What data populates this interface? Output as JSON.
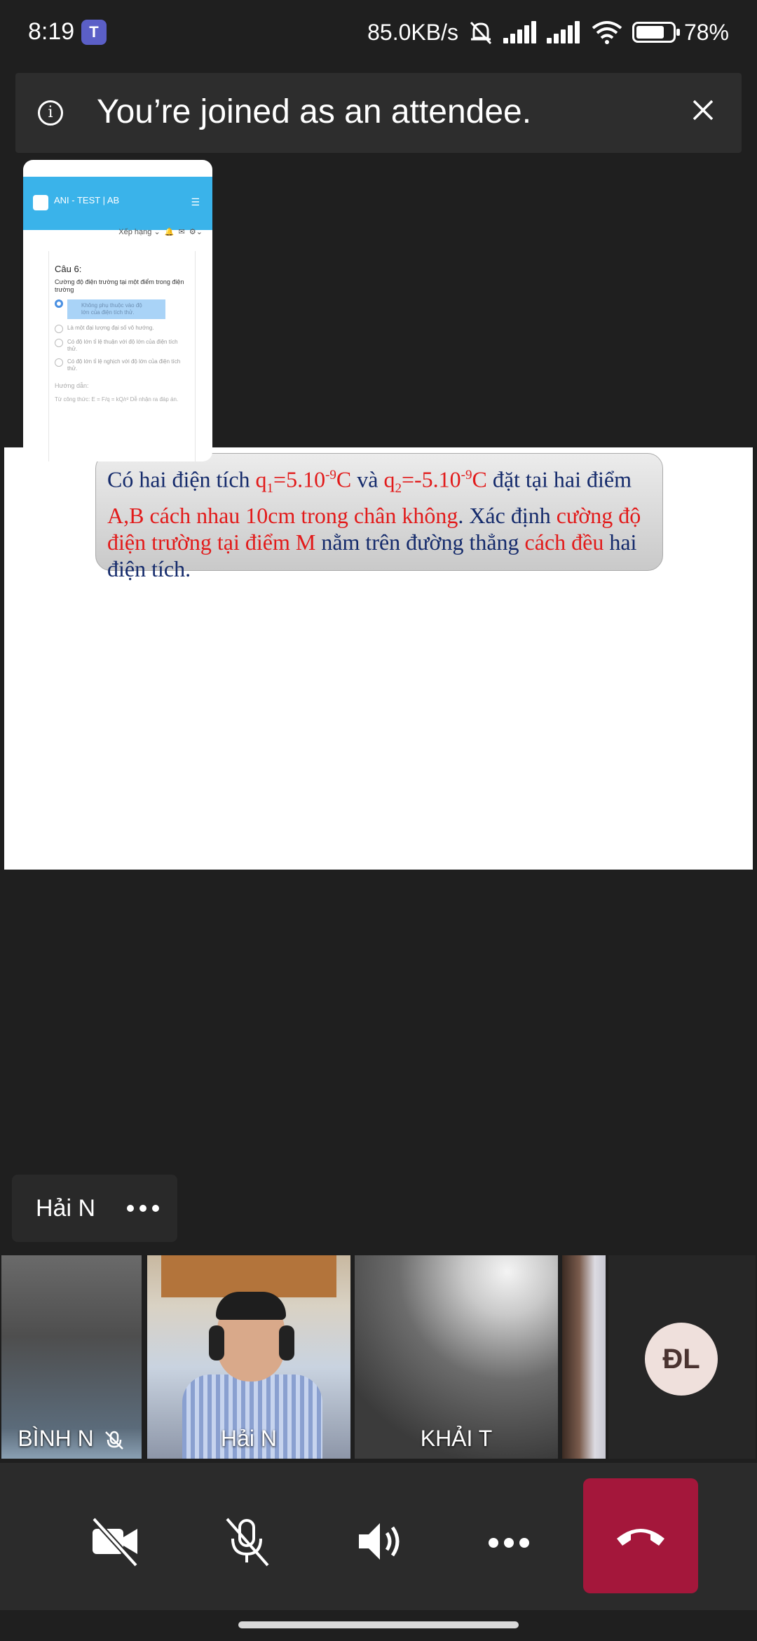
{
  "status_bar": {
    "time": "8:19",
    "network_speed": "85.0KB/s",
    "battery": "78%",
    "battery_level": 0.78
  },
  "banner": {
    "text": "You’re joined as an attendee."
  },
  "shared_slide": {
    "parts": [
      {
        "text": "Có hai điện tích ",
        "color": "blue"
      },
      {
        "text": "q",
        "color": "red"
      },
      {
        "text": "1",
        "color": "red",
        "sub": true
      },
      {
        "text": "=5.10",
        "color": "red"
      },
      {
        "text": "-9",
        "color": "red",
        "sup": true
      },
      {
        "text": "C",
        "color": "red"
      },
      {
        "text": " và ",
        "color": "blue"
      },
      {
        "text": "q",
        "color": "red"
      },
      {
        "text": "2",
        "color": "red",
        "sub": true
      },
      {
        "text": "=-5.10",
        "color": "red"
      },
      {
        "text": "-9",
        "color": "red",
        "sup": true
      },
      {
        "text": "C",
        "color": "red"
      },
      {
        "text": " đặt tại hai điểm ",
        "color": "blue"
      },
      {
        "text": "A,B cách nhau 10cm trong chân không",
        "color": "red"
      },
      {
        "text": ". Xác định ",
        "color": "blue"
      },
      {
        "text": "cường độ điện trường tại điểm M",
        "color": "red"
      },
      {
        "text": " nằm trên đường thẳng ",
        "color": "blue"
      },
      {
        "text": "cách đều",
        "color": "red"
      },
      {
        "text": " hai điện tích.",
        "color": "blue"
      }
    ]
  },
  "preview": {
    "app_title": "ANI - TEST | AB",
    "toolbar_label": "Xếp hạng",
    "question_number": "Câu 6:",
    "question_text": "Cường độ điện trường tại một điểm trong điện trường",
    "options": [
      {
        "text": "Không phụ thuộc vào độ lớn của điện tích thử.",
        "selected": true
      },
      {
        "text": "Là một đại lượng đại số vô hướng.",
        "selected": false
      },
      {
        "text": "Có độ lớn tỉ lệ thuận với độ lớn của điện tích thử.",
        "selected": false
      },
      {
        "text": "Có độ lớn tỉ lệ nghịch với độ lớn của điện tích thử.",
        "selected": false
      }
    ],
    "hint_label": "Hướng dẫn:",
    "formula_text": "Từ công thức: E = F/q = kQ/r² Dễ nhận ra đáp án."
  },
  "active_speaker": {
    "name": "Hải N"
  },
  "participants": [
    {
      "name": "BÌNH N",
      "muted": true
    },
    {
      "name": "Hải N",
      "muted": false
    },
    {
      "name": "KHẢI T",
      "muted": false
    },
    {
      "name": "",
      "muted": false
    },
    {
      "initials": "ĐL"
    }
  ],
  "controls": {
    "camera": "camera-off",
    "mic": "mic-off",
    "speaker": "speaker-on",
    "more": "more",
    "end_call": "end-call"
  },
  "colors": {
    "end_call": "#a4173b",
    "background": "#1f1f1f",
    "slide_blue": "#142a6b",
    "slide_red": "#e21a1a"
  }
}
